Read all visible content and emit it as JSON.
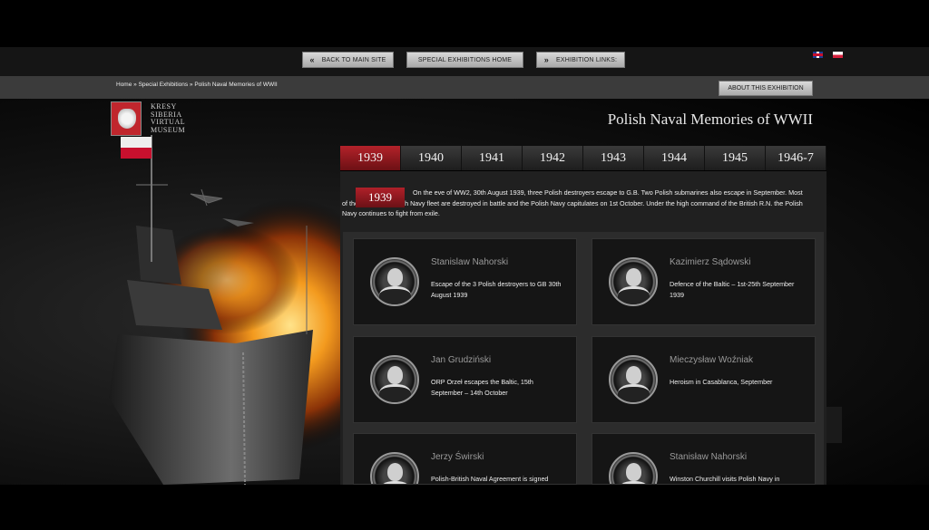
{
  "nav": {
    "back_label": "BACK TO MAIN SITE",
    "back_icon": "«",
    "home_label": "SPECIAL EXHIBITIONS HOME",
    "links_label": "EXHIBITION LINKS:",
    "links_icon": "»"
  },
  "breadcrumb": "Home » Special Exhibitions » Polish Naval Memories of WWII",
  "about_label": "ABOUT THIS EXHIBITION",
  "logo": {
    "line1": "KRESY",
    "line2": "SIBERIA",
    "line3": "VIRTUAL",
    "line4": "MUSEUM"
  },
  "title": "Polish Naval Memories of WWII",
  "years": [
    "1939",
    "1940",
    "1941",
    "1942",
    "1943",
    "1944",
    "1945",
    "1946-7"
  ],
  "intro": {
    "year": "1939",
    "text": "On the eve of WW2, 30th August 1939, three Polish destroyers escape to G.B. Two Polish submarines also escape in September. Most of the remaining Polish Navy fleet are destroyed in battle and the Polish Navy capitulates on 1st October. Under the high command of the British R.N. the Polish Navy continues to fight from exile."
  },
  "cards": [
    {
      "name": "Stanislaw Nahorski",
      "desc": "Escape of the 3 Polish destroyers to GB 30th August 1939"
    },
    {
      "name": "Kazimierz Sądowski",
      "desc": "Defence of the Baltic – 1st-25th September 1939"
    },
    {
      "name": "Jan Grudziński",
      "desc": "ORP Orzeł escapes the Baltic, 15th September – 14th October"
    },
    {
      "name": "Mieczysław Woźniak",
      "desc": "Heroism in Casablanca, September"
    },
    {
      "name": "Jerzy Świrski",
      "desc": "Polish-British Naval Agreement is signed"
    },
    {
      "name": "Stanisław Nahorski",
      "desc": "Winston Churchill visits Polish Navy in"
    }
  ],
  "colors": {
    "accent_red": "#b3222a",
    "panel": "#202020",
    "card": "#151515"
  }
}
